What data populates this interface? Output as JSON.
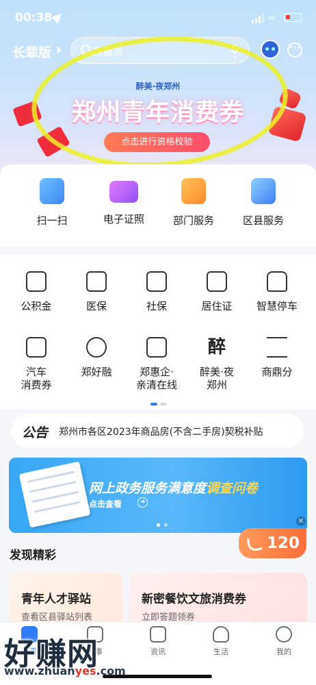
{
  "status_bar": {
    "time": "00:38"
  },
  "header": {
    "elder_mode": "长辈版",
    "search_placeholder": "存量房"
  },
  "banner": {
    "subtitle": "醉美·夜郑州",
    "title": "郑州青年消费券",
    "cta": "点击进行资格校验"
  },
  "quick_services": [
    {
      "label": "扫一扫",
      "color": "#4a9cf7"
    },
    {
      "label": "电子证照",
      "color": "#b05cf0"
    },
    {
      "label": "部门服务",
      "color": "#ff9a3c"
    },
    {
      "label": "区县服务",
      "color": "#3d8ef5"
    }
  ],
  "services": [
    {
      "label": "公积金"
    },
    {
      "label": "医保"
    },
    {
      "label": "社保"
    },
    {
      "label": "居住证"
    },
    {
      "label": "智慧停车"
    },
    {
      "label": "汽车\n消费券"
    },
    {
      "label": "郑好融"
    },
    {
      "label": "郑惠企·\n亲清在线"
    },
    {
      "label": "醉美·夜\n郑州"
    },
    {
      "label": "商鼎分"
    }
  ],
  "notice": {
    "tag": "公告",
    "text": "郑州市各区2023年商品房(不含二手房)契税补贴"
  },
  "survey": {
    "title_prefix": "网上政务服务满意度",
    "title_highlight": "调查问卷",
    "link": "点击查看"
  },
  "hotline": {
    "number": "120"
  },
  "discover": {
    "title": "发现精彩",
    "cards": [
      {
        "title": "青年人才驿站",
        "subtitle": "查看区县驿站列表"
      },
      {
        "title": "新密餐饮文旅消费券",
        "subtitle": "立即答题领券"
      }
    ]
  },
  "tabbar": [
    {
      "label": "首页",
      "active": true
    },
    {
      "label": "办事",
      "active": false
    },
    {
      "label": "资讯",
      "active": false
    },
    {
      "label": "生活",
      "active": false
    },
    {
      "label": "我的",
      "active": false
    }
  ],
  "watermark": {
    "main": "好赚网",
    "url_prefix": "www.zhuan",
    "url_highlight": "yes",
    "url_suffix": ".com"
  }
}
